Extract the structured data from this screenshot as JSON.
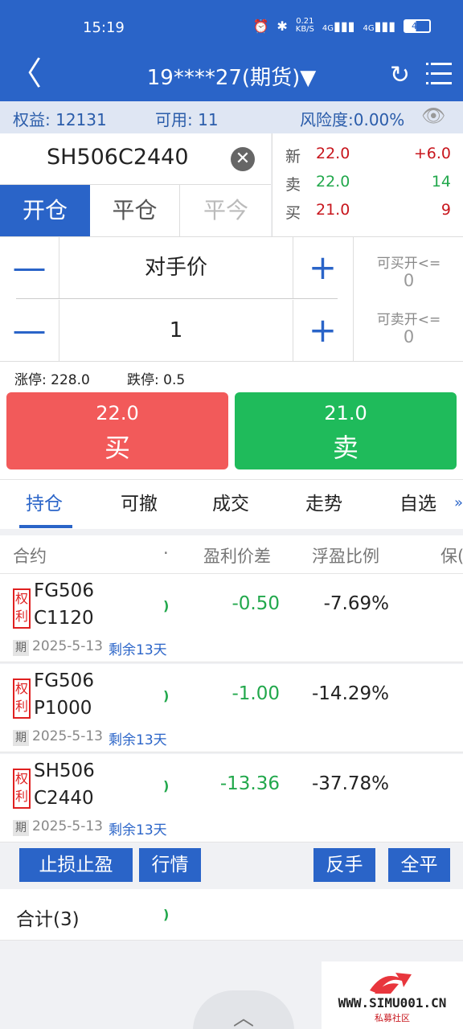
{
  "status": {
    "time": "15:19",
    "net_speed": "0.21",
    "net_unit": "KB/S",
    "sig1": "4G",
    "sig2": "4G",
    "battery": "45"
  },
  "header": {
    "title": "19****27(期货)▼"
  },
  "equity": {
    "equity": "权益: 12131",
    "available": "可用: 11",
    "risk": "风险度:0.00%"
  },
  "symbol": "SH506C2440",
  "quotes": [
    {
      "label": "新",
      "price": "22.0",
      "value": "+6.0",
      "value_color": "#c8161d"
    },
    {
      "label": "卖",
      "price": "22.0",
      "value": "14",
      "value_color": "#22a84c"
    },
    {
      "label": "买",
      "price": "21.0",
      "value": "9",
      "value_color": "#c8161d"
    }
  ],
  "open_tabs": {
    "open": "开仓",
    "close": "平仓",
    "close_today": "平今"
  },
  "order": {
    "price_type": "对手价",
    "quantity": "1",
    "can_buy_label": "可买开<=",
    "can_buy": "0",
    "can_sell_label": "可卖开<=",
    "can_sell": "0"
  },
  "limits": {
    "up": "涨停: 228.0",
    "down": "跌停: 0.5"
  },
  "buy": {
    "price": "22.0",
    "action": "买"
  },
  "sell": {
    "price": "21.0",
    "action": "卖"
  },
  "pos_tabs": [
    "持仓",
    "可撤",
    "成交",
    "走势",
    "自选"
  ],
  "columns": {
    "contract": "合约",
    "dot": "·",
    "diff": "盈利价差",
    "ratio": "浮盈比例",
    "extra": "保("
  },
  "positions": [
    {
      "tag": "权利",
      "line1": "FG506",
      "line2": "C1120",
      "dot": ")",
      "diff": "-0.50",
      "ratio": "-7.69%",
      "q": "期",
      "date": "2025-5-13",
      "remain": "剩余13天"
    },
    {
      "tag": "权利",
      "line1": "FG506",
      "line2": "P1000",
      "dot": ")",
      "diff": "-1.00",
      "ratio": "-14.29%",
      "q": "期",
      "date": "2025-5-13",
      "remain": "剩余13天"
    },
    {
      "tag": "权利",
      "line1": "SH506",
      "line2": "C2440",
      "dot": ")",
      "diff": "-13.36",
      "ratio": "-37.78%",
      "q": "期",
      "date": "2025-5-13",
      "remain": "剩余13天"
    }
  ],
  "actions": {
    "stoploss": "止损止盈",
    "market": "行情",
    "reverse": "反手",
    "close_all": "全平"
  },
  "total": {
    "label": "合计(3)",
    "dot": ")"
  },
  "watermark": {
    "url": "WWW.SIMU001.CN",
    "sub": "私募社区"
  }
}
